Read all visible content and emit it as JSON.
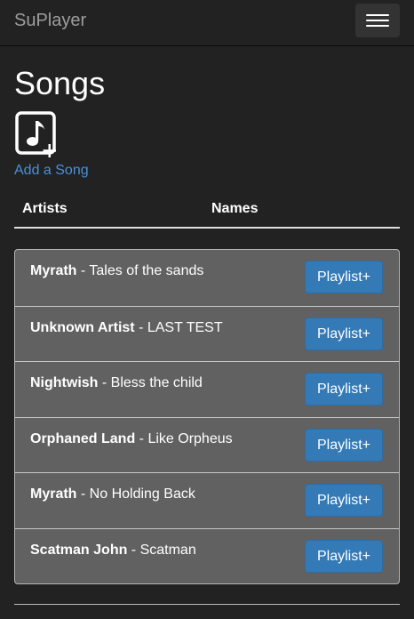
{
  "navbar": {
    "brand": "SuPlayer",
    "toggle_icon": "hamburger-menu-icon"
  },
  "page": {
    "title": "Songs",
    "add_icon": "music-note-add-icon",
    "add_link": "Add a Song"
  },
  "table": {
    "headers": [
      "Artists",
      "Names"
    ]
  },
  "songs": [
    {
      "artist": "Myrath",
      "separator": " - ",
      "name": "Tales of the sands",
      "button": "Playlist+"
    },
    {
      "artist": "Unknown Artist",
      "separator": " - ",
      "name": "LAST TEST",
      "button": "Playlist+"
    },
    {
      "artist": "Nightwish",
      "separator": " - ",
      "name": "Bless the child",
      "button": "Playlist+"
    },
    {
      "artist": "Orphaned Land",
      "separator": " - ",
      "name": "Like Orpheus",
      "button": "Playlist+"
    },
    {
      "artist": "Myrath",
      "separator": " - ",
      "name": "No Holding Back",
      "button": "Playlist+"
    },
    {
      "artist": "Scatman John",
      "separator": " - ",
      "name": "Scatman",
      "button": "Playlist+"
    }
  ],
  "colors": {
    "background": "#222222",
    "brand": "#9d9d9d",
    "link": "#4a90d9",
    "list_bg": "#616161",
    "button": "#337ab7"
  }
}
